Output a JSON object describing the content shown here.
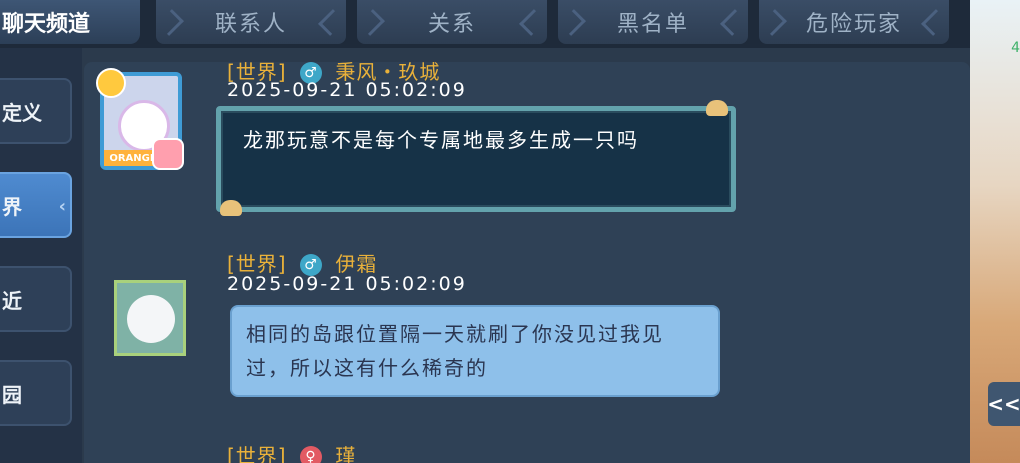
{
  "header": {
    "title": "聊天频道",
    "tabs": [
      {
        "label": "联系人"
      },
      {
        "label": "关系"
      },
      {
        "label": "黑名单"
      },
      {
        "label": "危险玩家"
      }
    ]
  },
  "sidebar": {
    "items": [
      {
        "label": "定义",
        "active": false
      },
      {
        "label": "界",
        "active": true
      },
      {
        "label": "近",
        "active": false
      },
      {
        "label": "园",
        "active": false
      }
    ]
  },
  "messages": [
    {
      "channel": "[世界]",
      "gender": "male",
      "gender_symbol": "♂",
      "name": "秉风・玖城",
      "timestamp": "2025-09-21  05:02:09",
      "text": "龙那玩意不是每个专属地最多生成一只吗",
      "bubble_style": "dark",
      "avatar_badge": "ORANGE"
    },
    {
      "channel": "[世界]",
      "gender": "male",
      "gender_symbol": "♂",
      "name": "伊霜",
      "timestamp": "2025-09-21  05:02:09",
      "text": "相同的岛跟位置隔一天就刷了你没见过我见过，所以这有什么稀奇的",
      "bubble_style": "light"
    },
    {
      "channel": "[世界]",
      "gender": "female",
      "gender_symbol": "♀",
      "name": "瑾"
    }
  ],
  "scene": {
    "number": "4",
    "collapse_glyph": "<<"
  },
  "colors": {
    "channel": "#e9b13a",
    "male": "#3ea7c8",
    "female": "#e25a63",
    "active_tab": "#4f8bd0"
  }
}
